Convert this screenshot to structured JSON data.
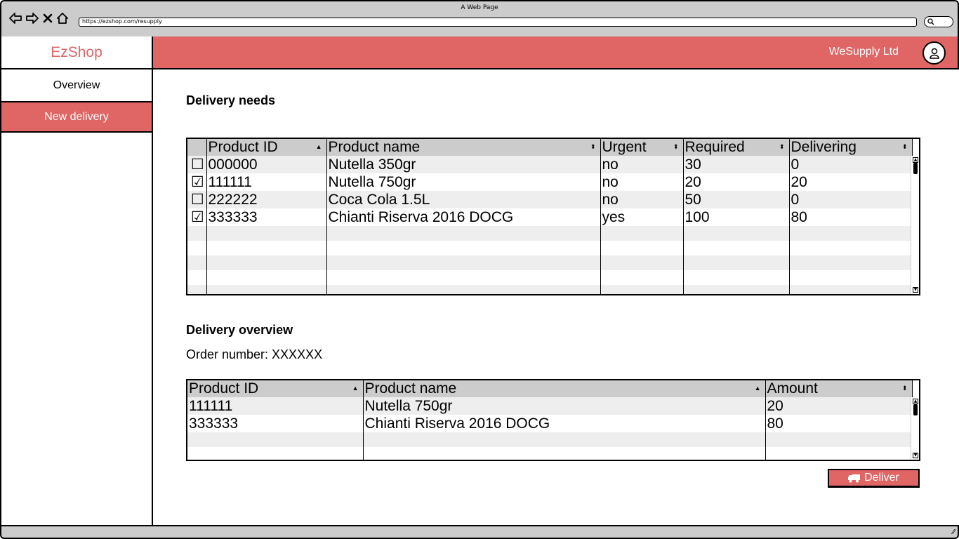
{
  "browser": {
    "window_title": "A Web Page",
    "url": "https://ezshop.com/resupply"
  },
  "sidebar": {
    "logo": "EzShop",
    "items": [
      {
        "label": "Overview",
        "active": false
      },
      {
        "label": "New delivery",
        "active": true
      }
    ]
  },
  "header": {
    "company": "WeSupply Ltd"
  },
  "delivery_needs": {
    "title": "Delivery needs",
    "columns": [
      "Product ID",
      "Product name",
      "Urgent",
      "Required",
      "Delivering"
    ],
    "rows": [
      {
        "checked": false,
        "id": "000000",
        "name": "Nutella 350gr",
        "urgent": "no",
        "required": "30",
        "delivering": "0"
      },
      {
        "checked": true,
        "id": "111111",
        "name": "Nutella 750gr",
        "urgent": "no",
        "required": "20",
        "delivering": "20"
      },
      {
        "checked": false,
        "id": "222222",
        "name": "Coca Cola 1.5L",
        "urgent": "no",
        "required": "50",
        "delivering": "0"
      },
      {
        "checked": true,
        "id": "333333",
        "name": "Chianti Riserva 2016 DOCG",
        "urgent": "yes",
        "required": "100",
        "delivering": "80"
      }
    ]
  },
  "delivery_overview": {
    "title": "Delivery overview",
    "order_label": "Order number: XXXXXX",
    "columns": [
      "Product ID",
      "Product name",
      "Amount"
    ],
    "rows": [
      {
        "id": "111111",
        "name": "Nutella 750gr",
        "amount": "20"
      },
      {
        "id": "333333",
        "name": "Chianti Riserva 2016 DOCG",
        "amount": "80"
      }
    ]
  },
  "actions": {
    "deliver_label": "Deliver",
    "deliver_icon": "truck-icon"
  },
  "colors": {
    "accent": "#e06666",
    "header_grey": "#cccccc"
  }
}
